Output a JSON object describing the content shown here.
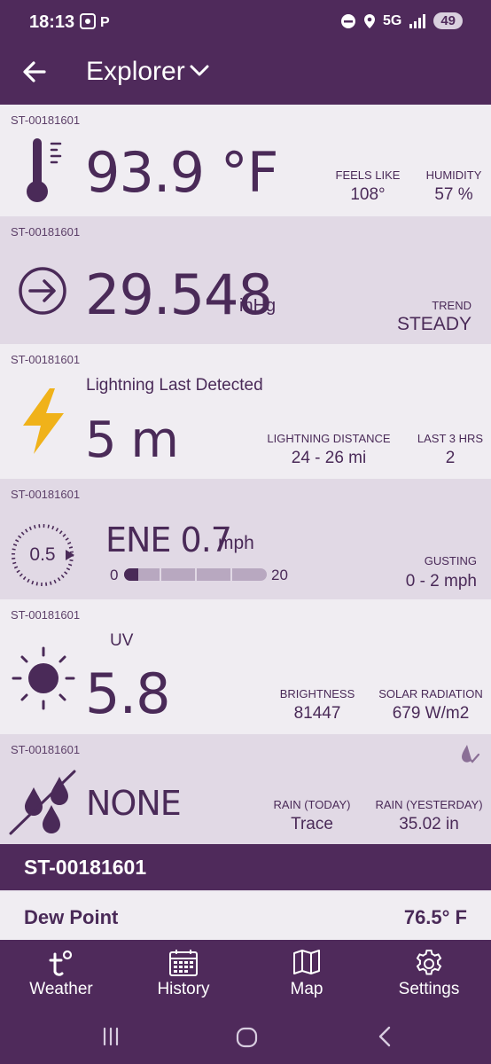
{
  "status_bar": {
    "time": "18:13",
    "network": "5G",
    "battery": "49"
  },
  "app_bar": {
    "title": "Explorer",
    "back_icon": "arrow-left-icon",
    "dropdown_icon": "chevron-down-icon"
  },
  "cards": {
    "temperature": {
      "station": "ST-00181601",
      "value": "93.9 °F",
      "feels_like_label": "FEELS LIKE",
      "feels_like_value": "108°",
      "humidity_label": "HUMIDITY",
      "humidity_value": "57 %"
    },
    "pressure": {
      "station": "ST-00181601",
      "value": "29.548",
      "unit": "inHg",
      "trend_label": "TREND",
      "trend_value": "STEADY"
    },
    "lightning": {
      "station": "ST-00181601",
      "caption": "Lightning Last Detected",
      "value": "5 m",
      "distance_label": "LIGHTNING DISTANCE",
      "distance_value": "24 - 26 mi",
      "last3_label": "LAST 3 HRS",
      "last3_value": "2"
    },
    "wind": {
      "station": "ST-00181601",
      "dial_value": "0.5",
      "direction_speed": "ENE 0.7",
      "unit": "mph",
      "scale_min": "0",
      "scale_max": "20",
      "gust_fraction": 0.1,
      "gusting_label": "GUSTING",
      "gusting_value": "0 - 2 mph"
    },
    "uv": {
      "station": "ST-00181601",
      "caption": "UV",
      "value": "5.8",
      "brightness_label": "BRIGHTNESS",
      "brightness_value": "81447",
      "solar_label": "SOLAR RADIATION",
      "solar_value": "679 W/m2"
    },
    "rain": {
      "station": "ST-00181601",
      "value": "NONE",
      "today_label": "RAIN (TODAY)",
      "today_value": "Trace",
      "yesterday_label": "RAIN (YESTERDAY)",
      "yesterday_value": "35.02 in"
    }
  },
  "device_bar": {
    "name": "ST-00181601"
  },
  "dew_point": {
    "label": "Dew Point",
    "value": "76.5° F"
  },
  "bottom_nav": [
    {
      "label": "Weather",
      "icon": "tempest-logo-icon"
    },
    {
      "label": "History",
      "icon": "calendar-icon"
    },
    {
      "label": "Map",
      "icon": "map-icon"
    },
    {
      "label": "Settings",
      "icon": "gear-icon"
    }
  ],
  "colors": {
    "brand_purple": "#4f2a5b",
    "text_purple": "#4a2a58",
    "lightning_yellow": "#f0b21a"
  }
}
